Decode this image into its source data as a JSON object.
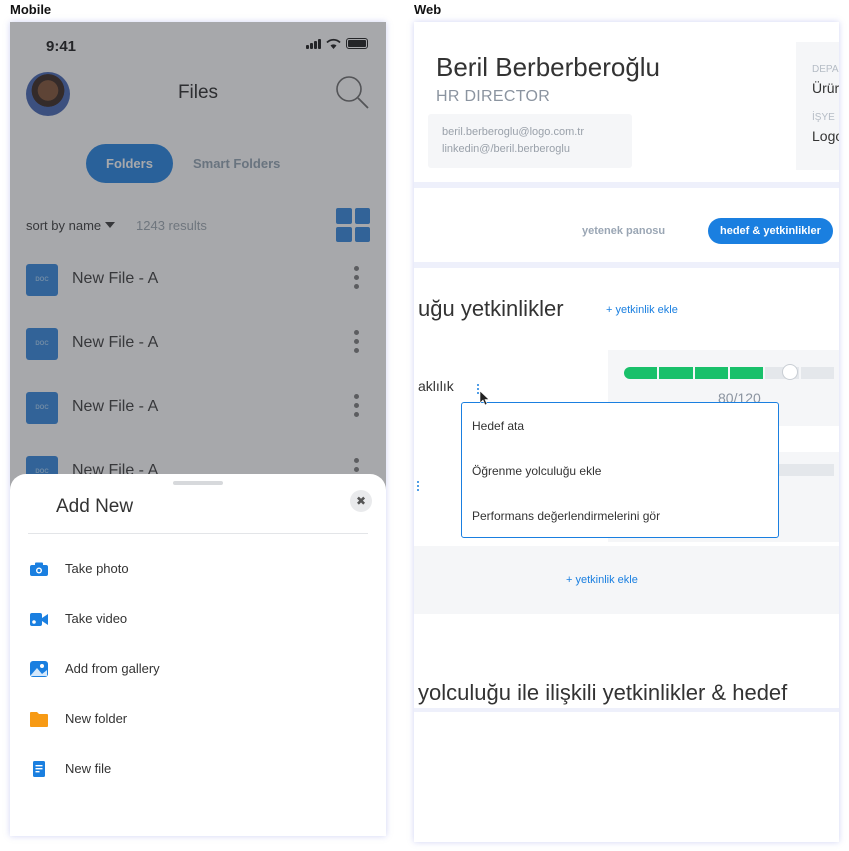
{
  "labels": {
    "mobile": "Mobile",
    "web": "Web"
  },
  "mobile": {
    "status_time": "9:41",
    "header_title": "Files",
    "segments": {
      "active": "Folders",
      "inactive": "Smart Folders"
    },
    "sort_label": "sort by name",
    "results": "1243 results",
    "files": [
      {
        "name": "New File - A",
        "badge": "DOC"
      },
      {
        "name": "New File - A",
        "badge": "DOC"
      },
      {
        "name": "New File - A",
        "badge": "DOC"
      },
      {
        "name": "New File - A",
        "badge": "DOC"
      }
    ],
    "sheet": {
      "title": "Add New",
      "close_glyph": "✖",
      "actions": [
        {
          "label": "Take photo",
          "icon": "camera-icon",
          "color": "#1a7fe0"
        },
        {
          "label": "Take video",
          "icon": "video-icon",
          "color": "#1a7fe0"
        },
        {
          "label": "Add from gallery",
          "icon": "gallery-icon",
          "color": "#1a7fe0"
        },
        {
          "label": "New folder",
          "icon": "folder-icon",
          "color": "#f79a14"
        },
        {
          "label": "New file",
          "icon": "file-icon",
          "color": "#1a7fe0"
        }
      ]
    }
  },
  "web": {
    "name": "Beril Berberberoğlu",
    "role": "HR DIRECTOR",
    "email": "beril.berberoglu@logo.com.tr",
    "linkedin": "linkedin@/beril.berberoglu",
    "side": {
      "label1": "DEPA",
      "value1": "Ürür",
      "label2": "İŞYE",
      "value2": "Logo"
    },
    "tabs": {
      "plain": "yetenek panosu",
      "active": "hedef & yetkinlikler"
    },
    "heading1": "uğu yetkinlikler",
    "add_link": "+ yetkinlik ekle",
    "skill_label": "aklılık",
    "progress": {
      "current": 80,
      "max": 120,
      "text": "80/120"
    },
    "menu_items": [
      "Hedef ata",
      "Öğrenme yolculuğu ekle",
      "Performans değerlendirmelerini gör"
    ],
    "add_link_bottom": "+ yetkinlik ekle",
    "heading2": "yolculuğu ile ilişkili yetkinlikler & hedef"
  },
  "colors": {
    "accent": "#1a7fe0",
    "success": "#19c06a",
    "folder": "#f79a14"
  }
}
